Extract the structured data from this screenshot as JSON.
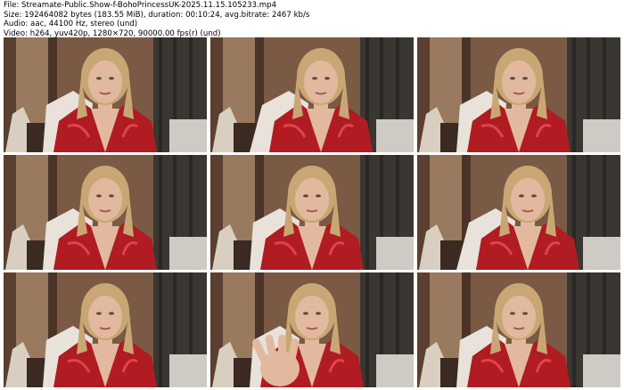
{
  "header": {
    "file_line": "File: Streamate-Public.Show-f-BohoPrincessUK-2025.11.15.105233.mp4",
    "size_line": "Size: 192464082 bytes (183.55 MiB), duration: 00:10:24, avg.bitrate: 2467 kb/s",
    "audio_line": "Audio: aac, 44100 Hz, stereo (und)",
    "video_line": "Video: h264, yuv420p, 1280×720, 90000.00 fps(r) (und)"
  },
  "thumbnails": [
    {
      "pose": "center"
    },
    {
      "pose": "lean-right"
    },
    {
      "pose": "center"
    },
    {
      "pose": "center"
    },
    {
      "pose": "center"
    },
    {
      "pose": "lean-right"
    },
    {
      "pose": "center"
    },
    {
      "pose": "hand-raised"
    },
    {
      "pose": "center"
    }
  ],
  "colors": {
    "wall": "#7a5a45",
    "curtain": "#3a3632",
    "robe": "#b01c22",
    "skin": "#e2b99f",
    "hair": "#c9a774"
  }
}
